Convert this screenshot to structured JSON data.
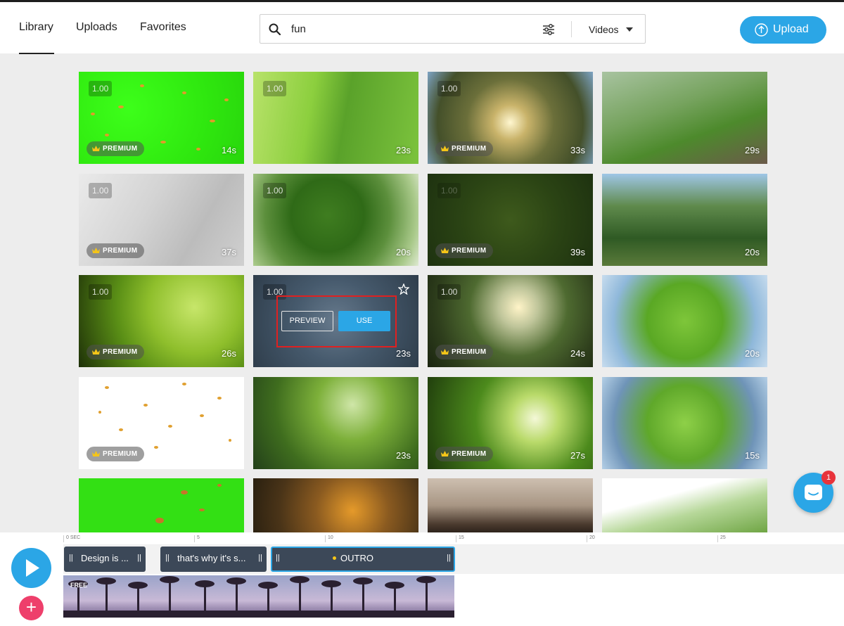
{
  "header": {
    "tabs": [
      {
        "label": "Library",
        "active": true
      },
      {
        "label": "Uploads",
        "active": false
      },
      {
        "label": "Favorites",
        "active": false
      }
    ],
    "search": {
      "value": "fun",
      "type_label": "Videos"
    },
    "upload_label": "Upload"
  },
  "colors": {
    "accent": "#2ba6e6",
    "badge_red": "#e8333b",
    "add_pink": "#ee3f6b",
    "clip_dark": "#3c4858"
  },
  "tiles": [
    {
      "rating": "1.00",
      "duration": "14s",
      "premium": true
    },
    {
      "rating": "1.00",
      "duration": "23s",
      "premium": false
    },
    {
      "rating": "1.00",
      "duration": "33s",
      "premium": true
    },
    {
      "rating": "",
      "duration": "29s",
      "premium": false
    },
    {
      "rating": "1.00",
      "duration": "37s",
      "premium": true
    },
    {
      "rating": "1.00",
      "duration": "20s",
      "premium": false
    },
    {
      "rating": "1.00",
      "duration": "39s",
      "premium": true
    },
    {
      "rating": "",
      "duration": "20s",
      "premium": false
    },
    {
      "rating": "1.00",
      "duration": "26s",
      "premium": true
    },
    {
      "rating": "1.00",
      "duration": "23s",
      "premium": false,
      "hover": true
    },
    {
      "rating": "1.00",
      "duration": "24s",
      "premium": true
    },
    {
      "rating": "",
      "duration": "20s",
      "premium": false
    },
    {
      "rating": "",
      "duration": "",
      "premium": true
    },
    {
      "rating": "",
      "duration": "23s",
      "premium": false
    },
    {
      "rating": "",
      "duration": "27s",
      "premium": true
    },
    {
      "rating": "",
      "duration": "15s",
      "premium": false
    },
    {
      "rating": "",
      "duration": "",
      "premium": false
    },
    {
      "rating": "",
      "duration": "",
      "premium": false
    },
    {
      "rating": "",
      "duration": "",
      "premium": false
    },
    {
      "rating": "",
      "duration": "",
      "premium": false
    }
  ],
  "premium_label": "PREMIUM",
  "hover_actions": {
    "preview": "PREVIEW",
    "use": "USE"
  },
  "chat": {
    "unread": "1"
  },
  "timeline": {
    "ruler": [
      "0 SEC",
      "5",
      "10",
      "15",
      "20",
      "25"
    ],
    "clips": [
      {
        "label": "Design is ...",
        "selected": false
      },
      {
        "label": "that's why it's s...",
        "selected": false
      },
      {
        "label": "OUTRO",
        "selected": true
      }
    ],
    "music_label": "FREE",
    "grip": "||"
  }
}
